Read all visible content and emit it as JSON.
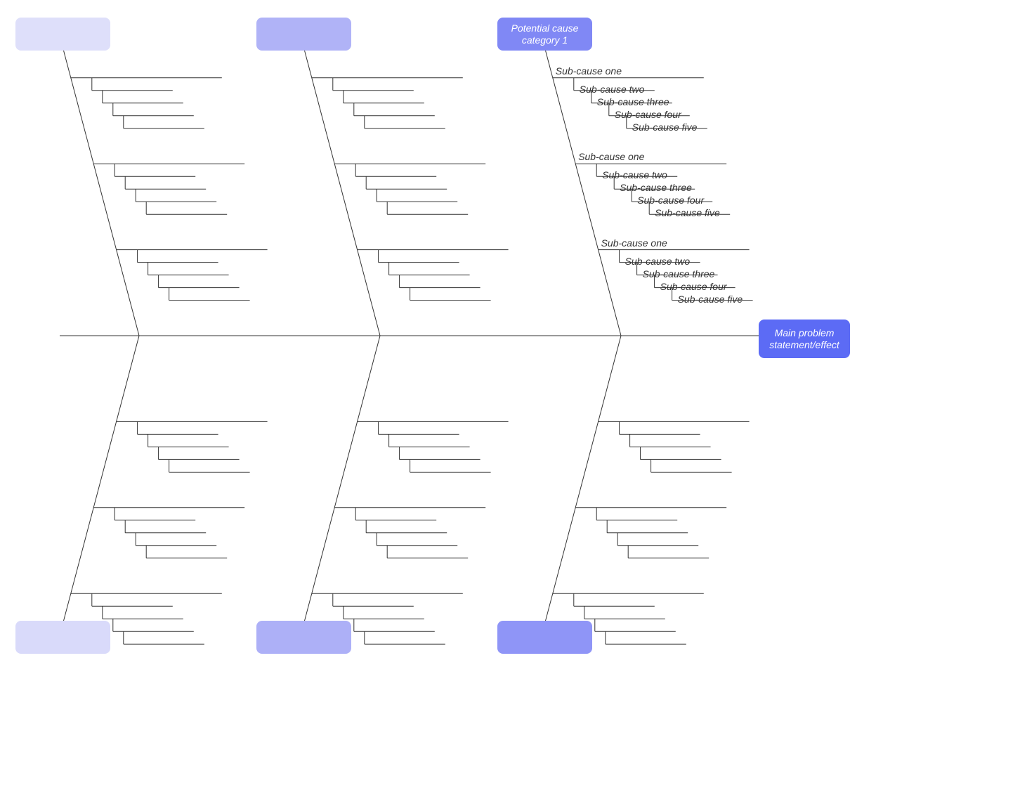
{
  "main_problem": "Main problem statement/effect",
  "categories": {
    "top_right": "Potential cause category 1",
    "top_middle": "",
    "top_left": "",
    "bottom_right": "",
    "bottom_middle": "",
    "bottom_left": ""
  },
  "subcauses": {
    "one": "Sub-cause one",
    "two": "Sub-cause two",
    "three": "Sub-cause three",
    "four": "Sub-cause four",
    "five": "Sub-cause five"
  },
  "colors": {
    "main": "#5c6bf5",
    "cat_top_right": "#8088f5",
    "cat_top_middle": "#b0b3f7",
    "cat_top_left": "#dedffa",
    "cat_bottom_right": "#8f95f7",
    "cat_bottom_middle": "#adb0f7",
    "cat_bottom_left": "#d9dafa"
  },
  "chart_data": {
    "type": "table",
    "template": "Fishbone / Ishikawa cause-and-effect diagram",
    "effect": "Main problem statement/effect",
    "cause_categories_count": 6,
    "labeled_categories": [
      "Potential cause category 1"
    ],
    "sub_cause_groups_per_category": 3,
    "sub_causes_per_group": [
      "Sub-cause one",
      "Sub-cause two",
      "Sub-cause three",
      "Sub-cause four",
      "Sub-cause five"
    ]
  }
}
